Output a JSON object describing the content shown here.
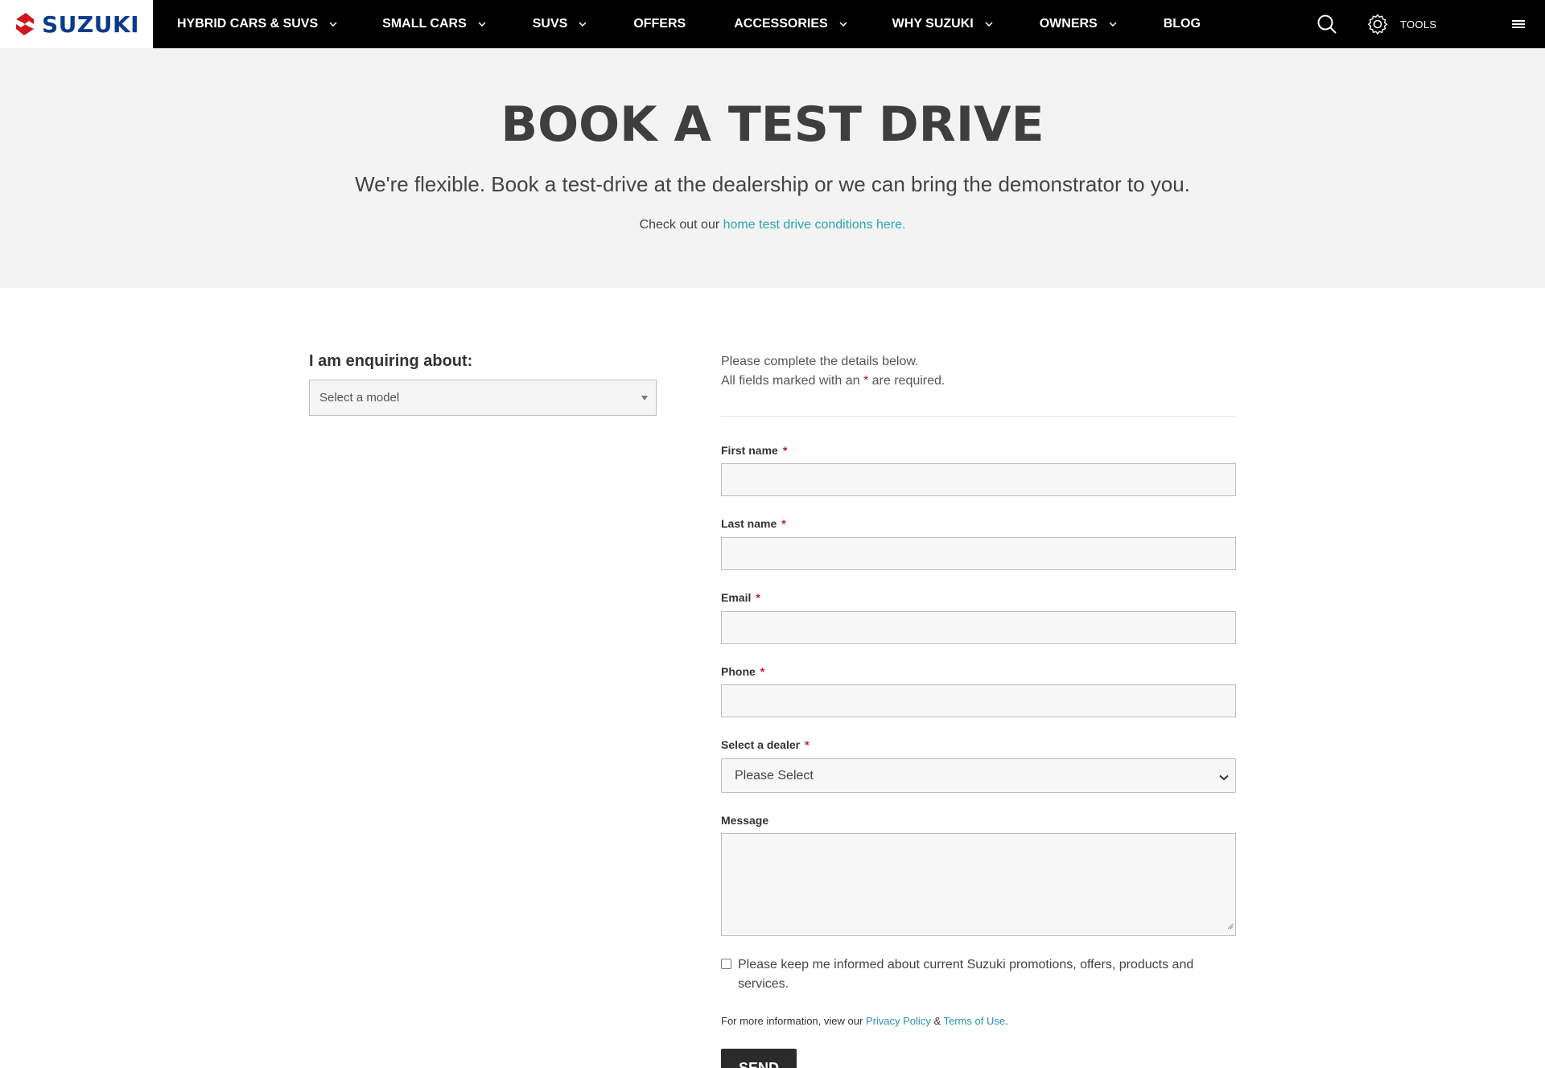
{
  "brand": {
    "name": "SUZUKI",
    "color": "#0b3a8c",
    "accent": "#d0161e"
  },
  "nav": {
    "items": [
      {
        "label": "HYBRID CARS & SUVS",
        "has_dropdown": true
      },
      {
        "label": "SMALL CARS",
        "has_dropdown": true
      },
      {
        "label": "SUVS",
        "has_dropdown": true
      },
      {
        "label": "OFFERS",
        "has_dropdown": false
      },
      {
        "label": "ACCESSORIES",
        "has_dropdown": true
      },
      {
        "label": "WHY SUZUKI",
        "has_dropdown": true
      },
      {
        "label": "OWNERS",
        "has_dropdown": true
      },
      {
        "label": "BLOG",
        "has_dropdown": false
      }
    ],
    "tools_label": "TOOLS",
    "icons": {
      "search": "search-icon",
      "tools": "gear-icon",
      "menu": "hamburger-icon"
    }
  },
  "hero": {
    "title": "BOOK A TEST DRIVE",
    "subtitle": "We're flexible. Book a test-drive at the dealership or we can bring the demonstrator to you.",
    "note_prefix": "Check out our ",
    "note_link": "home test drive conditions here."
  },
  "enquiry": {
    "label": "I am enquiring about:",
    "select_placeholder": "Select a model"
  },
  "form": {
    "intro_line1": "Please complete the details below.",
    "intro_line2_prefix": "All fields marked with an ",
    "required_mark": "*",
    "intro_line2_suffix": " are required.",
    "fields": {
      "first_name": "First name",
      "last_name": "Last name",
      "email": "Email",
      "phone": "Phone",
      "dealer": "Select a dealer",
      "message": "Message"
    },
    "dealer_value": "Please Select",
    "checkbox_label": "Please keep me informed about current Suzuki promotions, offers, products and services.",
    "checkbox_checked": false,
    "more_info_prefix": "For more information, view our ",
    "privacy_link": "Privacy Policy",
    "amp": " & ",
    "terms_link": "Terms of Use",
    "more_info_suffix": ".",
    "submit_label": "SEND"
  },
  "colors": {
    "link": "#2aa6b4",
    "required": "#c0171c",
    "nav_bg": "#000000",
    "hero_bg": "#f3f3f3"
  }
}
